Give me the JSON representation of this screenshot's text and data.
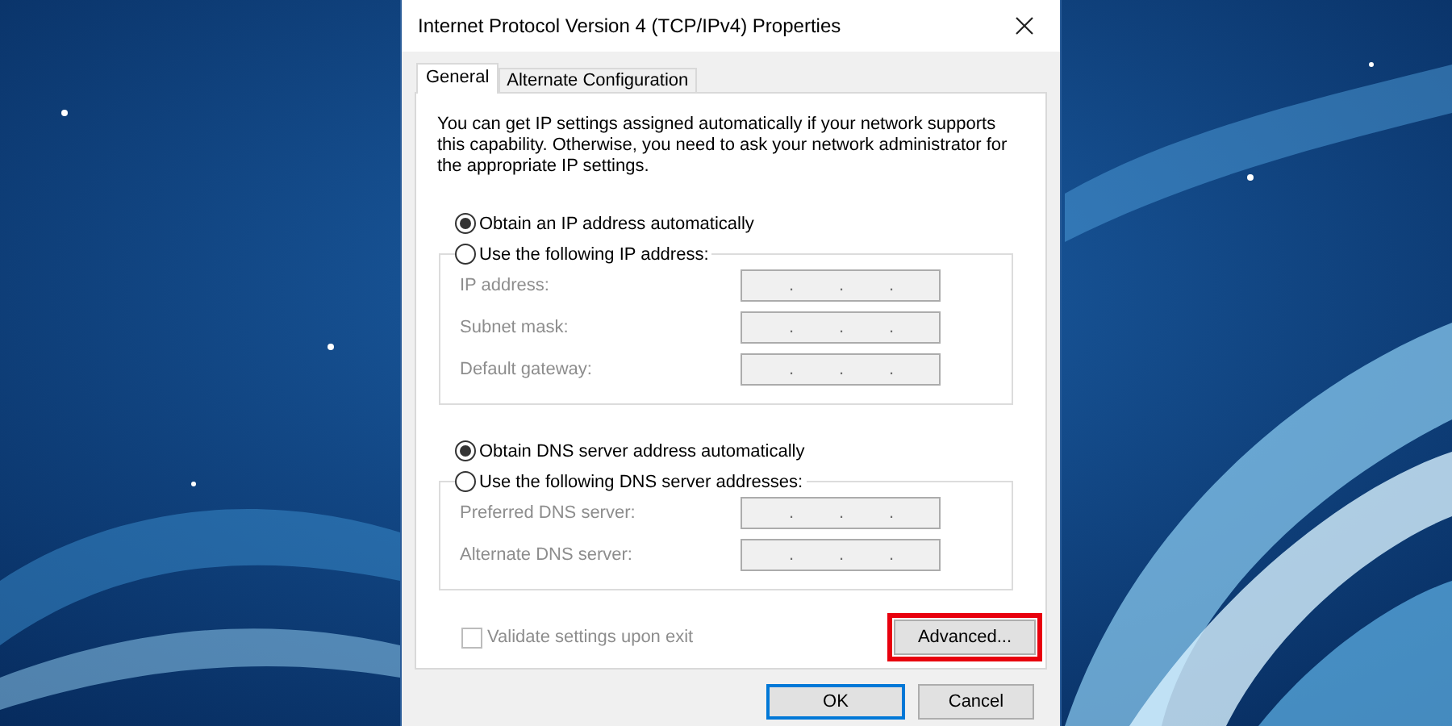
{
  "window": {
    "title": "Internet Protocol Version 4 (TCP/IPv4) Properties"
  },
  "tabs": [
    {
      "label": "General",
      "selected": true
    },
    {
      "label": "Alternate Configuration",
      "selected": false
    }
  ],
  "description": "You can get IP settings assigned automatically if your network supports this capability. Otherwise, you need to ask your network administrator for the appropriate IP settings.",
  "sections": [
    {
      "auto_option": {
        "label": "Obtain an IP address automatically",
        "selected": true
      },
      "manual_option": {
        "label": "Use the following IP address:",
        "selected": false
      },
      "disabled": true,
      "fields": [
        {
          "label": "IP address:",
          "separators": [
            ".",
            ".",
            "."
          ]
        },
        {
          "label": "Subnet mask:",
          "separators": [
            ".",
            ".",
            "."
          ]
        },
        {
          "label": "Default gateway:",
          "separators": [
            ".",
            ".",
            "."
          ]
        }
      ]
    },
    {
      "auto_option": {
        "label": "Obtain DNS server address automatically",
        "selected": true
      },
      "manual_option": {
        "label": "Use the following DNS server addresses:",
        "selected": false
      },
      "disabled": true,
      "fields": [
        {
          "label": "Preferred DNS server:",
          "separators": [
            ".",
            ".",
            "."
          ]
        },
        {
          "label": "Alternate DNS server:",
          "separators": [
            ".",
            ".",
            "."
          ]
        }
      ]
    }
  ],
  "validate_checkbox": {
    "label": "Validate settings upon exit",
    "checked": false,
    "disabled": true
  },
  "advanced_button": {
    "label": "Advanced...",
    "highlighted": true
  },
  "buttons": [
    {
      "label": "OK",
      "default": true
    },
    {
      "label": "Cancel",
      "default": false
    }
  ]
}
